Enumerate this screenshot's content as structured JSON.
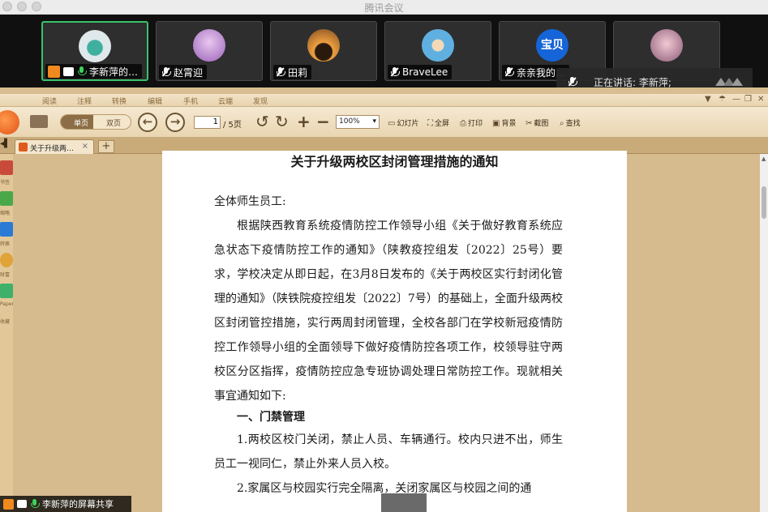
{
  "window": {
    "title": "腾讯会议"
  },
  "participants": [
    {
      "name": "李新萍的…",
      "active": true,
      "avatar_color": "#8fb3c9"
    },
    {
      "name": "赵霄迎",
      "active": false,
      "avatar_color": "#b27fc9"
    },
    {
      "name": "田莉",
      "active": false,
      "avatar_color": "#c98a3d"
    },
    {
      "name": "BraveLee",
      "active": false,
      "avatar_color": "#6fa6d6"
    },
    {
      "name": "亲亲我的…",
      "active": false,
      "avatar_text": "宝贝",
      "avatar_color": "#1565d8"
    },
    {
      "name": "",
      "active": false,
      "avatar_color": "#c9a2b0"
    }
  ],
  "speaking": {
    "label": "正在讲话: 李新萍;"
  },
  "reader": {
    "menu_tabs": [
      "阅读",
      "注释",
      "转换",
      "编辑",
      "手机",
      "云端",
      "发现"
    ],
    "view_single": "单页",
    "view_double": "双页",
    "page_current": "1",
    "page_total": "/ 5页",
    "zoom": "100%",
    "tools": [
      "幻灯片",
      "全屏",
      "打印",
      "背景",
      "截图",
      "查找"
    ],
    "tab_title": "关于升级两…",
    "left_labels": [
      "书签",
      "缩略",
      "转换",
      "财富",
      "Paper",
      "收藏"
    ]
  },
  "document": {
    "title": "关于升级两校区封闭管理措施的通知",
    "salutation": "全体师生员工:",
    "para1": "根据陕西教育系统疫情防控工作领导小组《关于做好教育系统应急状态下疫情防控工作的通知》（陕教疫控组发〔2022〕25号）要求，学校决定从即日起，在3月8日发布的《关于两校区实行封闭化管理的通知》（陕铁院疫控组发〔2022〕7号）的基础上，全面升级两校区封闭管控措施，实行两周封闭管理，全校各部门在学校新冠疫情防控工作领导小组的全面领导下做好疫情防控各项工作，校领导驻守两校区分区指挥，疫情防控应急专班协调处理日常防控工作。现就相关事宜通知如下:",
    "section1": "一、门禁管理",
    "item1": "1.两校区校门关闭，禁止人员、车辆通行。校内只进不出，师生员工一视同仁，禁止外来人员入校。",
    "item2": "2.家属区与校园实行完全隔离，关闭家属区与校园之间的通"
  },
  "share": {
    "label": "李新萍的屏幕共享"
  }
}
